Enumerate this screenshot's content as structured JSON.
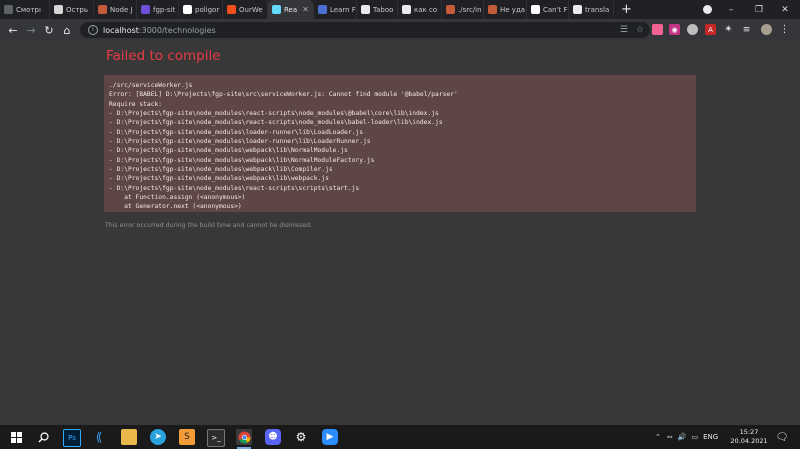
{
  "browser": {
    "tabs": [
      {
        "label": "Смотрı",
        "favicon": "video-icon",
        "color": "#5f6368"
      },
      {
        "label": "Острь",
        "favicon": "bookmark-icon",
        "color": "#d7d7d7"
      },
      {
        "label": "Node J",
        "favicon": "code-icon",
        "color": "#c45b3a"
      },
      {
        "label": "fgp-sit",
        "favicon": "project-icon",
        "color": "#6d4fd6"
      },
      {
        "label": "poligor",
        "favicon": "github-icon",
        "color": "#ffffff"
      },
      {
        "label": "OurWe",
        "favicon": "figma-icon",
        "color": "#f24e1e"
      },
      {
        "label": "Rea",
        "favicon": "react-icon",
        "color": "#61dafb",
        "active": true
      },
      {
        "label": "Learn F",
        "favicon": "doc-icon",
        "color": "#4a6fd3"
      },
      {
        "label": "Taboo",
        "favicon": "google-icon",
        "color": "#e8eaed"
      },
      {
        "label": "как со",
        "favicon": "google-icon",
        "color": "#e8eaed"
      },
      {
        "label": "./src/in",
        "favicon": "code-icon",
        "color": "#c45b3a"
      },
      {
        "label": "Не уда",
        "favicon": "code-icon",
        "color": "#c45b3a"
      },
      {
        "label": "Can't F",
        "favicon": "github-icon",
        "color": "#ffffff"
      },
      {
        "label": "transla",
        "favicon": "google-icon",
        "color": "#e8eaed"
      }
    ],
    "url_host": "localhost",
    "url_path": ":3000/technologies"
  },
  "page": {
    "title": "Failed to compile",
    "stack_lines": [
      "./src/serviceWorker.js",
      "Error: [BABEL] D:\\Projects\\fgp-site\\src\\serviceWorker.js: Cannot find module '@babel/parser'",
      "Require stack:",
      "- D:\\Projects\\fgp-site\\node_modules\\react-scripts\\node_modules\\@babel\\core\\lib\\index.js",
      "- D:\\Projects\\fgp-site\\node_modules\\react-scripts\\node_modules\\babel-loader\\lib\\index.js",
      "- D:\\Projects\\fgp-site\\node_modules\\loader-runner\\lib\\LoadLoader.js",
      "- D:\\Projects\\fgp-site\\node_modules\\loader-runner\\lib\\LoaderRunner.js",
      "- D:\\Projects\\fgp-site\\node_modules\\webpack\\lib\\NormalModule.js",
      "- D:\\Projects\\fgp-site\\node_modules\\webpack\\lib\\NormalModuleFactory.js",
      "- D:\\Projects\\fgp-site\\node_modules\\webpack\\lib\\Compiler.js",
      "- D:\\Projects\\fgp-site\\node_modules\\webpack\\lib\\webpack.js",
      "- D:\\Projects\\fgp-site\\node_modules\\react-scripts\\scripts\\start.js",
      "    at Function.assign (<anonymous>)",
      "    at Generator.next (<anonymous>)"
    ],
    "footnote": "This error occurred during the build time and cannot be dismissed."
  },
  "taskbar": {
    "language": "ENG",
    "time": "15:27",
    "date": "20.04.2021"
  },
  "colors": {
    "error_title": "#e83b46",
    "stack_bg": "#5e4546",
    "page_bg": "#383838"
  }
}
